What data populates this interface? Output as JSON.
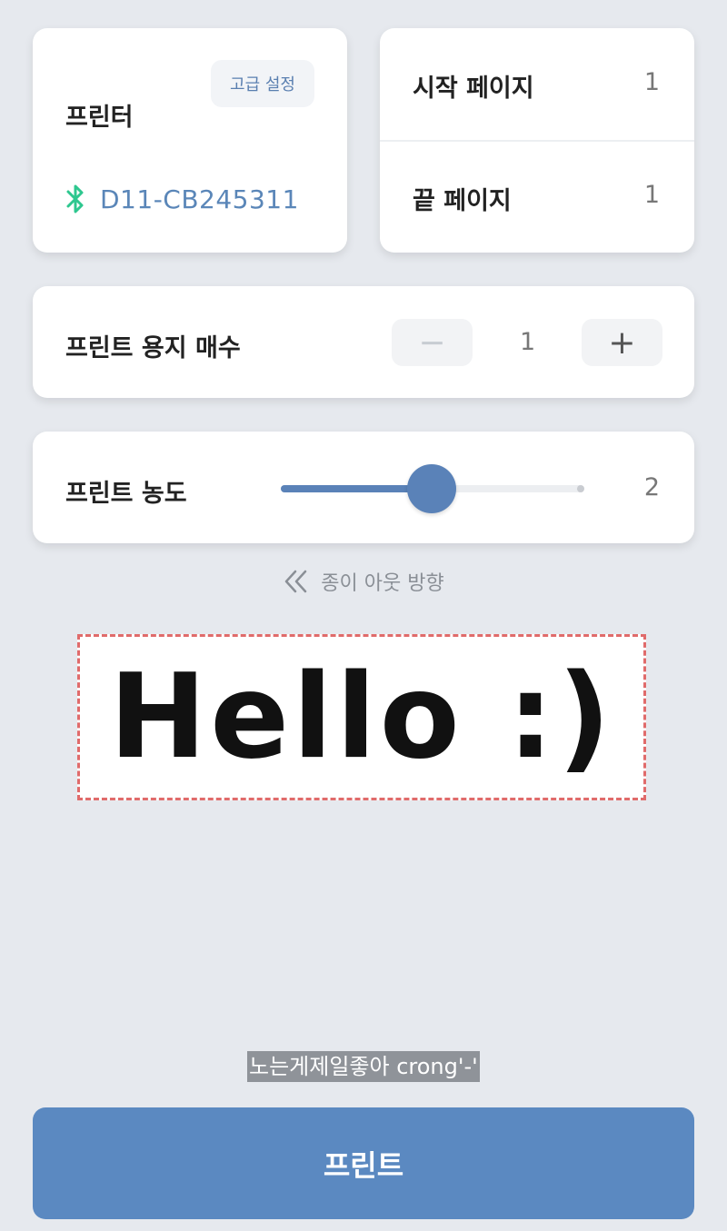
{
  "printer": {
    "title": "프린터",
    "advanced_label": "고급 설정",
    "device_name": "D11-CB245311",
    "bluetooth_icon": "bluetooth-icon",
    "bluetooth_color": "#2ec78f"
  },
  "pages": {
    "start_label": "시작 페이지",
    "start_value": "1",
    "end_label": "끝 페이지",
    "end_value": "1"
  },
  "copies": {
    "label": "프린트 용지 매수",
    "value": "1",
    "minus_symbol": "−",
    "plus_symbol": "+"
  },
  "density": {
    "label": "프린트 농도",
    "value": "2",
    "slider_fraction": 0.5
  },
  "direction": {
    "icon": "double-chevron-left-icon",
    "label": "종이 아웃 방향"
  },
  "preview": {
    "text": "Hello :)"
  },
  "caption": "노는게제일좋아 crong'-'",
  "print_button": {
    "label": "프린트"
  },
  "colors": {
    "accent": "#5b89c1",
    "background": "#e6e9ee",
    "preview_border": "#e06b6b"
  }
}
